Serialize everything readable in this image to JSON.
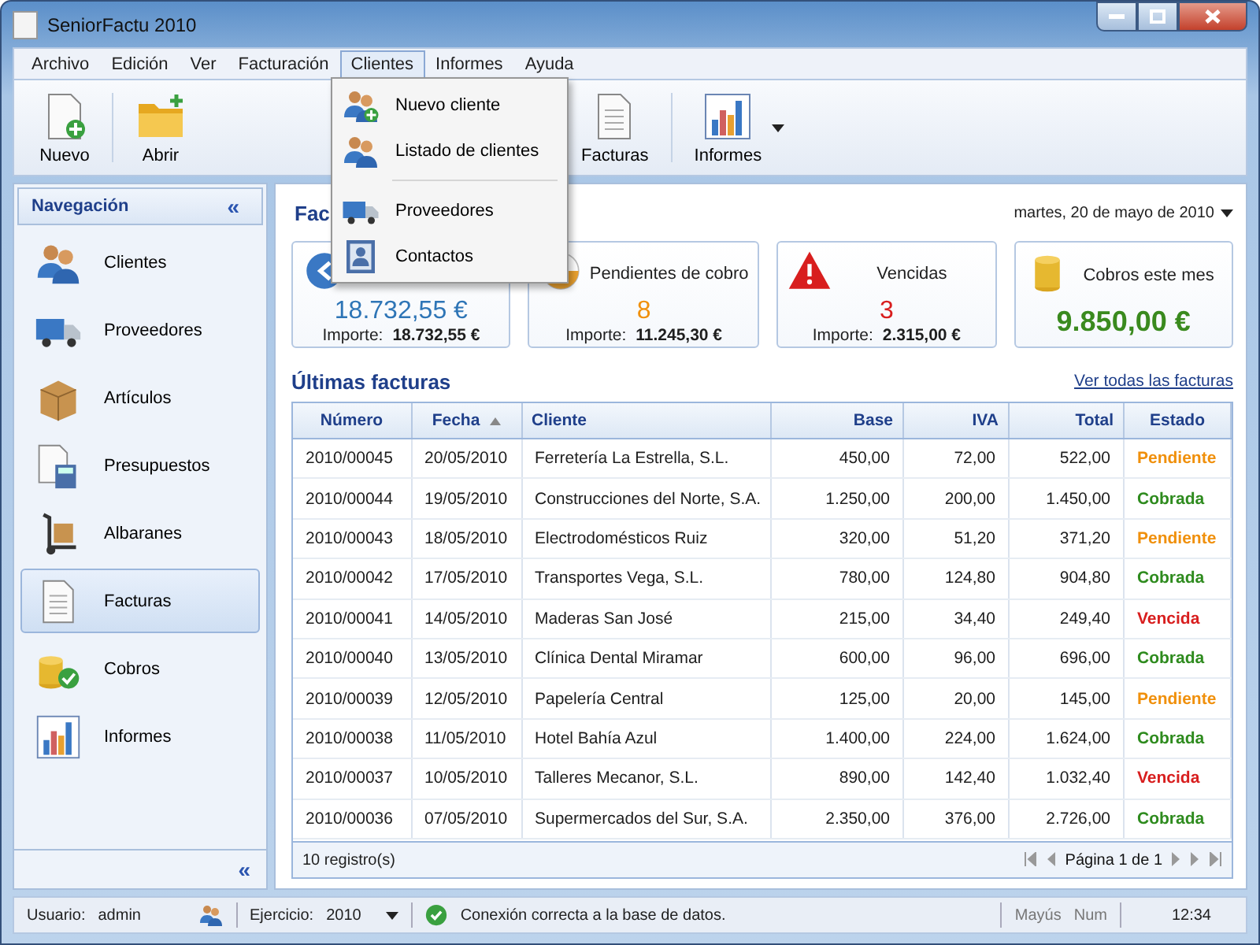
{
  "window": {
    "title": "SeniorFactu 2010"
  },
  "menu_bar": [
    {
      "label": "Archivo",
      "selected": false
    },
    {
      "label": "Edición",
      "selected": false
    },
    {
      "label": "Ver",
      "selected": false
    },
    {
      "label": "Facturación",
      "selected": false
    },
    {
      "label": "Clientes",
      "selected": true
    },
    {
      "label": "Informes",
      "selected": false
    },
    {
      "label": "Ayuda",
      "selected": false
    }
  ],
  "toolbar": [
    {
      "label": "Nuevo",
      "kind": "new"
    },
    {
      "label": "Abrir",
      "kind": "open"
    },
    {
      "label": "Facturas",
      "kind": "invoice"
    },
    {
      "label": "Informes",
      "kind": "chart"
    }
  ],
  "dropdown": [
    {
      "kind": "item",
      "label": "Nuevo cliente"
    },
    {
      "kind": "item",
      "label": "Listado de clientes"
    },
    {
      "kind": "separator"
    },
    {
      "kind": "item",
      "label": "Proveedores"
    },
    {
      "kind": "item",
      "label": "Contactos"
    }
  ],
  "sidebar": {
    "title": "Navegación",
    "collapse": "«",
    "footer_collapse": "«",
    "items": [
      {
        "label": "Clientes",
        "selected": false
      },
      {
        "label": "Proveedores",
        "selected": false
      },
      {
        "label": "Artículos",
        "selected": false
      },
      {
        "label": "Presupuestos",
        "selected": false
      },
      {
        "label": "Albaranes",
        "selected": false
      },
      {
        "label": "Facturas",
        "selected": true
      },
      {
        "label": "Cobros",
        "selected": false
      },
      {
        "label": "Informes",
        "selected": false
      }
    ]
  },
  "main": {
    "title": "Fac",
    "date": "martes, 20 de mayo de 2010",
    "cards": [
      {
        "kind": "total",
        "value": "18.732,55 €",
        "amount_label": "Importe:",
        "amount": "18.732,55 €",
        "color": "#2e75b6"
      },
      {
        "kind": "pending",
        "title": "Pendientes de cobro",
        "value": "8",
        "amount_label": "Importe:",
        "amount": "11.245,30 €",
        "color": "#f0900c"
      },
      {
        "kind": "overdue",
        "title": "Vencidas",
        "value": "3",
        "amount_label": "Importe:",
        "amount": "2.315,00 €",
        "color": "#d81e1e"
      },
      {
        "kind": "payments",
        "title": "Cobros este mes",
        "value": "9.850,00 €",
        "color": "#3a8a1e"
      }
    ],
    "section_title": "Últimas facturas",
    "see_all": "Ver todas las facturas",
    "table": {
      "columns": [
        {
          "label": "Número",
          "sorted": false
        },
        {
          "label": "Fecha",
          "sorted": true
        },
        {
          "label": "Cliente",
          "sorted": false
        },
        {
          "label": "Base",
          "sorted": false
        },
        {
          "label": "IVA",
          "sorted": false
        },
        {
          "label": "Total",
          "sorted": false
        },
        {
          "label": "Estado",
          "sorted": false
        }
      ],
      "rows": [
        {
          "cells": [
            "2010/00045",
            "20/05/2010",
            "Ferretería La Estrella, S.L.",
            "450,00",
            "72,00",
            "522,00"
          ],
          "status": "Pendiente",
          "color": "#f0900c"
        },
        {
          "cells": [
            "2010/00044",
            "19/05/2010",
            "Construcciones del Norte, S.A.",
            "1.250,00",
            "200,00",
            "1.450,00"
          ],
          "status": "Cobrada",
          "color": "#2e8b1e"
        },
        {
          "cells": [
            "2010/00043",
            "18/05/2010",
            "Electrodomésticos Ruiz",
            "320,00",
            "51,20",
            "371,20"
          ],
          "status": "Pendiente",
          "color": "#f0900c"
        },
        {
          "cells": [
            "2010/00042",
            "17/05/2010",
            "Transportes Vega, S.L.",
            "780,00",
            "124,80",
            "904,80"
          ],
          "status": "Cobrada",
          "color": "#2e8b1e"
        },
        {
          "cells": [
            "2010/00041",
            "14/05/2010",
            "Maderas San José",
            "215,00",
            "34,40",
            "249,40"
          ],
          "status": "Vencida",
          "color": "#d81e1e"
        },
        {
          "cells": [
            "2010/00040",
            "13/05/2010",
            "Clínica Dental Miramar",
            "600,00",
            "96,00",
            "696,00"
          ],
          "status": "Cobrada",
          "color": "#2e8b1e"
        },
        {
          "cells": [
            "2010/00039",
            "12/05/2010",
            "Papelería Central",
            "125,00",
            "20,00",
            "145,00"
          ],
          "status": "Pendiente",
          "color": "#f0900c"
        },
        {
          "cells": [
            "2010/00038",
            "11/05/2010",
            "Hotel Bahía Azul",
            "1.400,00",
            "224,00",
            "1.624,00"
          ],
          "status": "Cobrada",
          "color": "#2e8b1e"
        },
        {
          "cells": [
            "2010/00037",
            "10/05/2010",
            "Talleres Mecanor, S.L.",
            "890,00",
            "142,40",
            "1.032,40"
          ],
          "status": "Vencida",
          "color": "#d81e1e"
        },
        {
          "cells": [
            "2010/00036",
            "07/05/2010",
            "Supermercados del Sur, S.A.",
            "2.350,00",
            "376,00",
            "2.726,00"
          ],
          "status": "Cobrada",
          "color": "#2e8b1e"
        }
      ],
      "record_count": "10 registro(s)",
      "page": "Página 1 de 1"
    }
  },
  "status_bar": {
    "user_label": "Usuario:",
    "user": "admin",
    "year_label": "Ejercicio:",
    "year": "2010",
    "message": "Conexión correcta a la base de datos.",
    "caps": "Mayús",
    "num": "Num",
    "time": "12:34"
  }
}
